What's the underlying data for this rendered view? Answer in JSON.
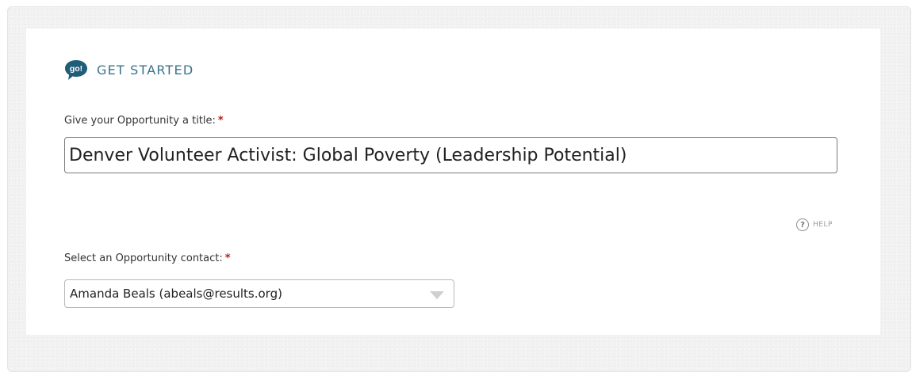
{
  "section": {
    "title": "GET STARTED",
    "icon": "go-speech-bubble-icon",
    "icon_text": "go!",
    "icon_color": "#1f5d78"
  },
  "title_field": {
    "label": "Give your Opportunity a title:",
    "required_marker": "*",
    "value": "Denver Volunteer Activist: Global Poverty (Leadership Potential)"
  },
  "help": {
    "icon": "help-circle-icon",
    "icon_text": "?",
    "label": "HELP"
  },
  "contact_field": {
    "label": "Select an Opportunity contact:",
    "required_marker": "*",
    "selected_value": "Amanda Beals (abeals@results.org)",
    "arrow_icon": "dropdown-triangle-icon"
  },
  "colors": {
    "accent": "#3a7288",
    "required": "#b81b1b",
    "icon": "#1f5d78"
  }
}
